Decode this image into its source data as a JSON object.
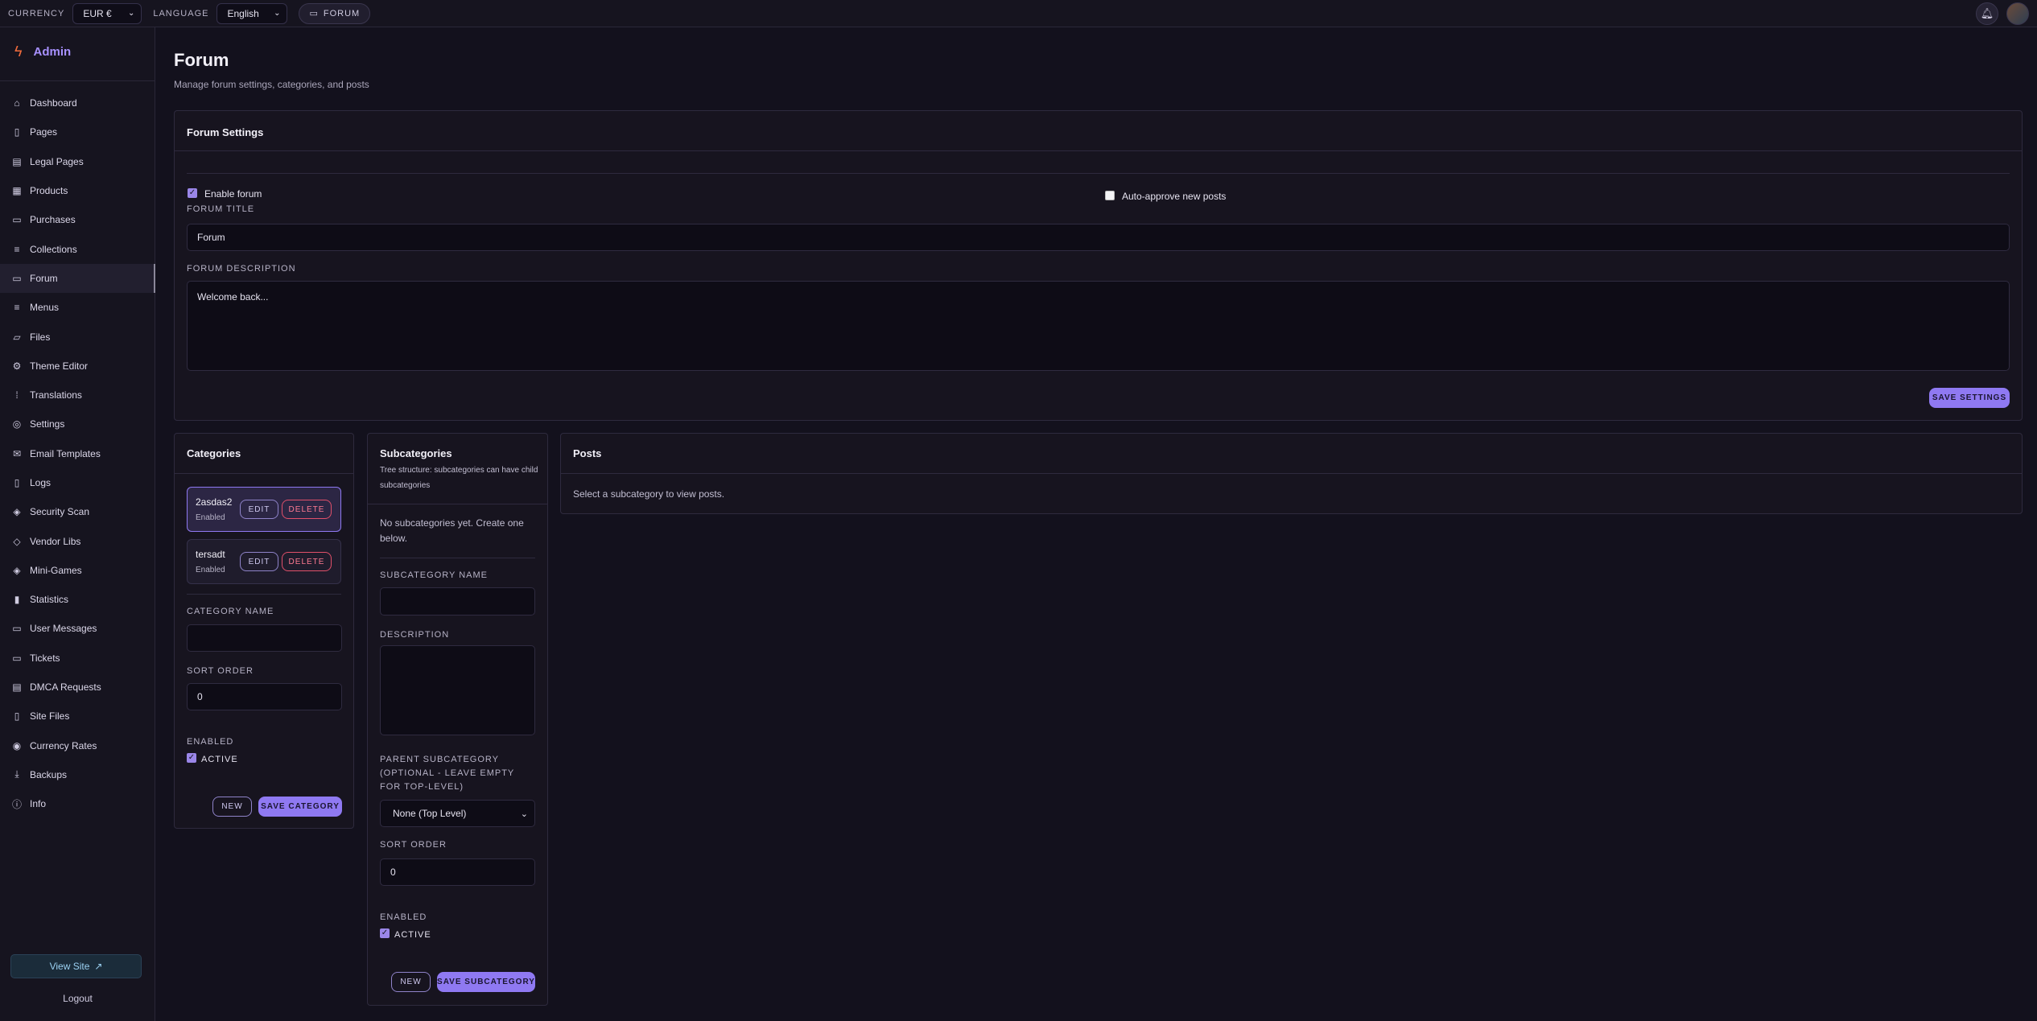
{
  "topbar": {
    "currency_label": "CURRENCY",
    "currency_value": "EUR €",
    "language_label": "LANGUAGE",
    "language_value": "English",
    "forum_chip": "FORUM"
  },
  "sidebar": {
    "brand": "Admin",
    "items": [
      {
        "label": "Dashboard",
        "icon": "home-icon"
      },
      {
        "label": "Pages",
        "icon": "page-icon"
      },
      {
        "label": "Legal Pages",
        "icon": "legal-page-icon"
      },
      {
        "label": "Products",
        "icon": "grid-icon"
      },
      {
        "label": "Purchases",
        "icon": "receipt-icon"
      },
      {
        "label": "Collections",
        "icon": "list-icon"
      },
      {
        "label": "Forum",
        "icon": "chat-icon"
      },
      {
        "label": "Menus",
        "icon": "menu-icon"
      },
      {
        "label": "Files",
        "icon": "folder-icon"
      },
      {
        "label": "Theme Editor",
        "icon": "gear-icon"
      },
      {
        "label": "Translations",
        "icon": "translate-icon"
      },
      {
        "label": "Settings",
        "icon": "settings-icon"
      },
      {
        "label": "Email Templates",
        "icon": "mail-icon"
      },
      {
        "label": "Logs",
        "icon": "log-icon"
      },
      {
        "label": "Security Scan",
        "icon": "shield-icon"
      },
      {
        "label": "Vendor Libs",
        "icon": "diamond-icon"
      },
      {
        "label": "Mini-Games",
        "icon": "layers-icon"
      },
      {
        "label": "Statistics",
        "icon": "bar-chart-icon"
      },
      {
        "label": "User Messages",
        "icon": "message-icon"
      },
      {
        "label": "Tickets",
        "icon": "ticket-icon"
      },
      {
        "label": "DMCA Requests",
        "icon": "document-icon"
      },
      {
        "label": "Site Files",
        "icon": "file-icon"
      },
      {
        "label": "Currency Rates",
        "icon": "currency-icon"
      },
      {
        "label": "Backups",
        "icon": "download-icon"
      },
      {
        "label": "Info",
        "icon": "info-icon"
      }
    ],
    "active_item": "Forum",
    "view_site": "View Site",
    "logout": "Logout"
  },
  "page": {
    "title": "Forum",
    "subtitle": "Manage forum settings, categories, and posts"
  },
  "forum_settings": {
    "title": "Forum Settings",
    "enable_forum_label": "Enable forum",
    "enable_forum_checked": true,
    "auto_approve_label": "Auto-approve new posts",
    "auto_approve_checked": false,
    "forum_title_label": "FORUM TITLE",
    "forum_title_value": "Forum",
    "forum_description_label": "FORUM DESCRIPTION",
    "forum_description_value": "Welcome back...",
    "save_button": "SAVE SETTINGS"
  },
  "categories": {
    "title": "Categories",
    "items": [
      {
        "name": "2asdas2",
        "status": "Enabled",
        "edit": "EDIT",
        "delete": "DELETE"
      },
      {
        "name": "tersadt",
        "status": "Enabled",
        "edit": "EDIT",
        "delete": "DELETE"
      }
    ],
    "category_name_label": "CATEGORY NAME",
    "category_name_value": "",
    "sort_order_label": "SORT ORDER",
    "sort_order_value": "0",
    "enabled_label": "ENABLED",
    "active_label": "ACTIVE",
    "active_checked": true,
    "new_button": "NEW",
    "save_button": "SAVE CATEGORY"
  },
  "subcategories": {
    "title": "Subcategories",
    "subtitle": "Tree structure: subcategories can have child subcategories",
    "empty_text": "No subcategories yet. Create one below.",
    "name_label": "SUBCATEGORY NAME",
    "name_value": "",
    "description_label": "DESCRIPTION",
    "description_value": "",
    "parent_label": "PARENT SUBCATEGORY (OPTIONAL - LEAVE EMPTY FOR TOP-LEVEL)",
    "parent_value": "None (Top Level)",
    "sort_order_label": "SORT ORDER",
    "sort_order_value": "0",
    "enabled_label": "ENABLED",
    "active_label": "ACTIVE",
    "active_checked": true,
    "new_button": "NEW",
    "save_button": "SAVE SUBCATEGORY"
  },
  "posts": {
    "title": "Posts",
    "empty_text": "Select a subcategory to view posts."
  },
  "colors": {
    "background": "#13111d",
    "accent": "#8f79f2",
    "brand": "#a891ff",
    "danger": "#e0506a"
  }
}
